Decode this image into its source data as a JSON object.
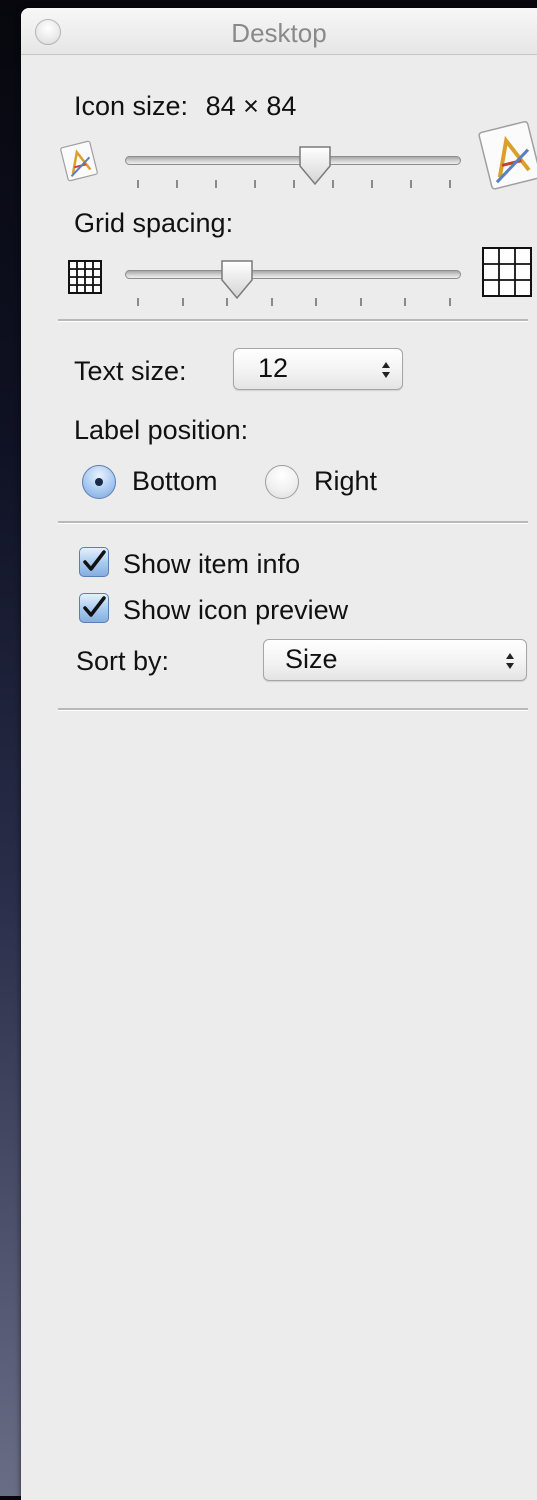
{
  "window": {
    "title": "Desktop"
  },
  "icon_size": {
    "label": "Icon size:",
    "value": "84 × 84",
    "slider_fraction": 0.57,
    "tick_count": 9,
    "small_icon": "app-document-small-icon",
    "large_icon": "app-document-large-icon"
  },
  "grid_spacing": {
    "label": "Grid spacing:",
    "slider_fraction": 0.32,
    "tick_count": 8,
    "small_icon": "grid-small-icon",
    "large_icon": "grid-large-icon"
  },
  "text_size": {
    "label": "Text size:",
    "value": "12"
  },
  "label_position": {
    "label": "Label position:",
    "options": [
      {
        "label": "Bottom",
        "selected": true
      },
      {
        "label": "Right",
        "selected": false
      }
    ]
  },
  "options": {
    "show_item_info": {
      "label": "Show item info",
      "checked": true
    },
    "show_icon_preview": {
      "label": "Show icon preview",
      "checked": true
    }
  },
  "sort_by": {
    "label": "Sort by:",
    "value": "Size"
  },
  "colors": {
    "panel_bg": "#ececec",
    "accent": "#7aa6dc",
    "text": "#111111",
    "title_text": "#8a8a8a"
  }
}
